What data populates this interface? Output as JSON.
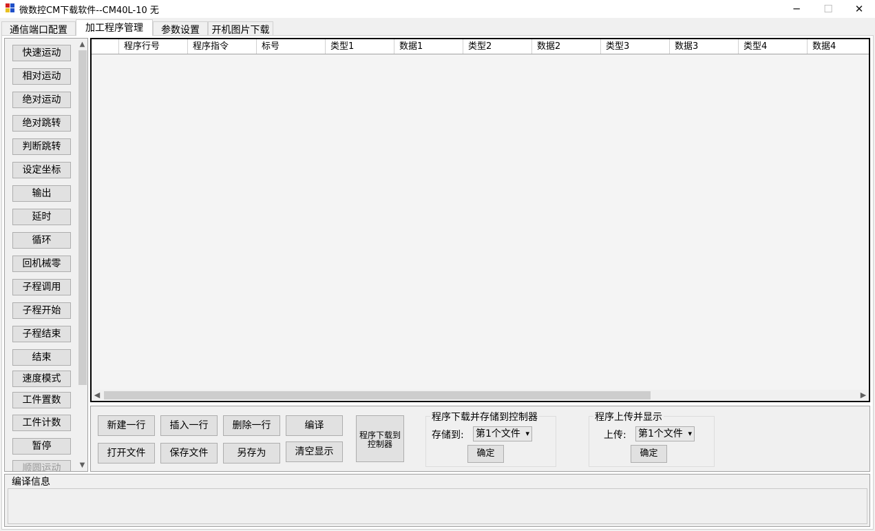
{
  "window": {
    "title": "微数控CM下载软件--CM40L-10   无",
    "minimize_glyph": "─",
    "maximize_glyph": "☐",
    "close_glyph": "✕"
  },
  "tabs": [
    {
      "label": "通信端口配置"
    },
    {
      "label": "加工程序管理"
    },
    {
      "label": "参数设置"
    },
    {
      "label": "开机图片下载"
    }
  ],
  "active_tab": "加工程序管理",
  "commands": [
    "快速运动",
    "相对运动",
    "绝对运动",
    "绝对跳转",
    "判断跳转",
    "设定坐标",
    "输出",
    "延时",
    "循环",
    "回机械零",
    "子程调用",
    "子程开始",
    "子程结束",
    "结束",
    "速度模式",
    "工件置数",
    "工件计数",
    "暂停",
    "顺圆运动"
  ],
  "grid": {
    "columns": [
      "",
      "程序行号",
      "程序指令",
      "标号",
      "类型1",
      "数据1",
      "类型2",
      "数据2",
      "类型3",
      "数据3",
      "类型4",
      "数据4"
    ]
  },
  "ops": {
    "new_row": "新建一行",
    "insert_row": "插入一行",
    "delete_row": "删除一行",
    "compile": "编译",
    "open_file": "打开文件",
    "save_file": "保存文件",
    "save_as": "另存为",
    "clear_display": "清空显示",
    "download_to_controller": "程序下载到控制器"
  },
  "download_group": {
    "legend": "程序下载并存储到控制器",
    "label": "存储到:",
    "selected": "第1个文件",
    "confirm": "确定"
  },
  "upload_group": {
    "legend": "程序上传并显示",
    "label": "上传:",
    "selected": "第1个文件",
    "confirm": "确定"
  },
  "compile_info": {
    "legend": "编译信息"
  },
  "icons": {
    "app": "app-icon",
    "scroll_up": "▲",
    "scroll_down": "▼",
    "scroll_left": "◀",
    "scroll_right": "▶",
    "dropdown": "▾"
  },
  "colors": {
    "window_bg": "#f0f0f0",
    "button_bg": "#e1e1e1",
    "grid_bg": "#f4f4f4",
    "icon_red": "#d42020",
    "icon_blue": "#2050c8",
    "icon_yellow": "#e8c020"
  }
}
